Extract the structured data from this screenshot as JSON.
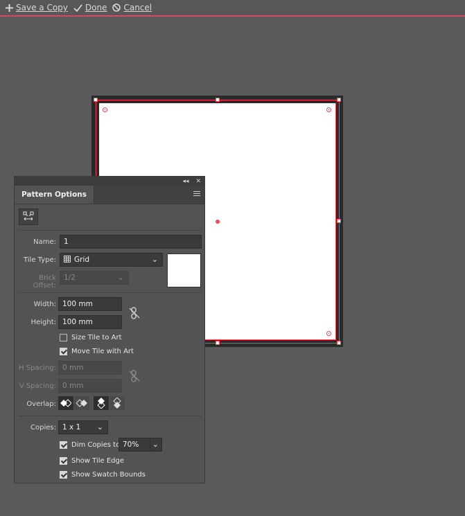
{
  "topbar": {
    "save_copy": "Save a Copy",
    "done": "Done",
    "cancel": "Cancel"
  },
  "panel": {
    "tab_title": "Pattern Options",
    "name": {
      "label": "Name:",
      "value": "1"
    },
    "tile_type": {
      "label": "Tile Type:",
      "value": "Grid"
    },
    "brick_offset": {
      "label": "Brick Offset:",
      "value": "1/2"
    },
    "width": {
      "label": "Width:",
      "value": "100 mm"
    },
    "height": {
      "label": "Height:",
      "value": "100 mm"
    },
    "size_tile_to_art": {
      "label": "Size Tile to Art",
      "checked": false
    },
    "move_tile_with_art": {
      "label": "Move Tile with Art",
      "checked": true
    },
    "h_spacing": {
      "label": "H Spacing:",
      "value": "0 mm"
    },
    "v_spacing": {
      "label": "V Spacing:",
      "value": "0 mm"
    },
    "overlap": {
      "label": "Overlap:"
    },
    "copies": {
      "label": "Copies:",
      "value": "1 x 1"
    },
    "dim_copies": {
      "label": "Dim Copies to:",
      "value": "70%",
      "checked": true
    },
    "show_tile_edge": {
      "label": "Show Tile Edge",
      "checked": true
    },
    "show_swatch_bounds": {
      "label": "Show Swatch Bounds",
      "checked": true
    }
  },
  "colors": {
    "accent": "#ff4655",
    "canvas": "#5a5a5a",
    "panel": "#535353"
  }
}
